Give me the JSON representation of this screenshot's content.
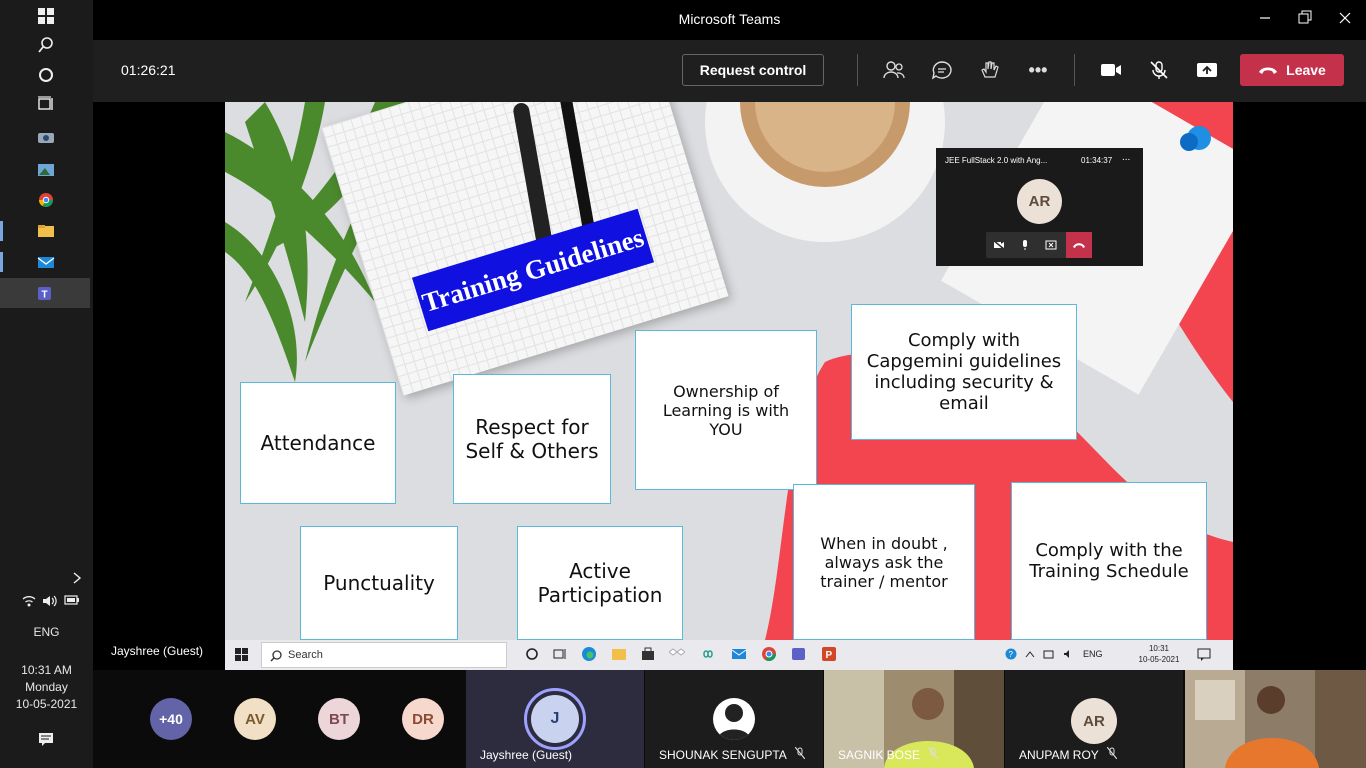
{
  "window": {
    "title": "Microsoft Teams"
  },
  "meeting": {
    "timer": "01:26:21",
    "request_control": "Request control",
    "leave": "Leave",
    "presenter_name": "Jayshree (Guest)"
  },
  "system_tray": {
    "language": "ENG",
    "time": "10:31 AM",
    "day": "Monday",
    "date": "10-05-2021"
  },
  "slide": {
    "title": "Training Guidelines",
    "cards": [
      "Attendance",
      "Respect for Self & Others",
      "Ownership of Learning is with YOU",
      "Comply with Capgemini guidelines including security & email",
      "Punctuality",
      "Active Participation",
      "When in doubt , always ask the trainer / mentor",
      "Comply with the Training Schedule"
    ],
    "colors": {
      "accent_red": "#f2454f",
      "banner_blue": "#1010e0"
    }
  },
  "mini_call": {
    "title": "JEE FullStack 2.0 with Ang...",
    "timer": "01:34:37",
    "avatar": "AR",
    "more": "..."
  },
  "shared_taskbar": {
    "search_placeholder": "Search",
    "language": "ENG",
    "time": "10:31",
    "date": "10-05-2021"
  },
  "participants": {
    "overflow": "+40",
    "avatars": [
      {
        "initials": "AV",
        "bg": "#f2e0c6",
        "fg": "#7a5a2c"
      },
      {
        "initials": "BT",
        "bg": "#ecd6d9",
        "fg": "#7d4a52"
      },
      {
        "initials": "DR",
        "bg": "#f6d9cc",
        "fg": "#8a4a33"
      }
    ],
    "tiles": [
      {
        "name": "Jayshree (Guest)",
        "initials": "J"
      },
      {
        "name": "SHOUNAK SENGUPTA"
      },
      {
        "name": "SAGNIK BOSE"
      },
      {
        "name": "ANUPAM ROY",
        "initials": "AR"
      }
    ]
  }
}
